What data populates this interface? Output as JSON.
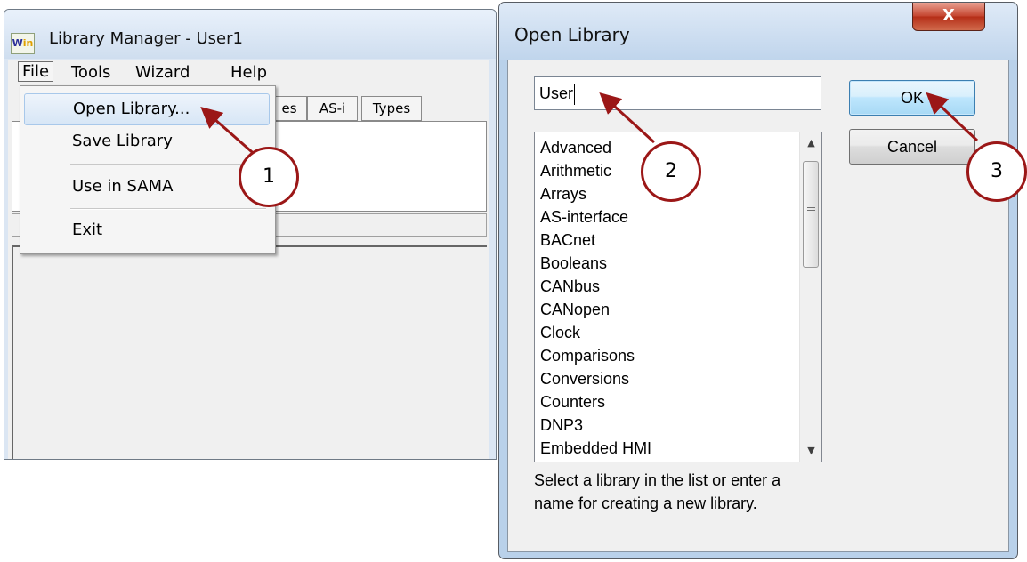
{
  "library_manager": {
    "title": "Library Manager - User1",
    "app_icon_text": "W",
    "app_icon_accent": "in",
    "menu": [
      "File",
      "Tools",
      "Wizard",
      "Help"
    ],
    "tabs": [
      "es",
      "AS-i",
      "Types"
    ],
    "file_menu": {
      "items": [
        "Open Library...",
        "Save Library",
        "Use in SAMA",
        "Exit"
      ],
      "highlighted": "Open Library..."
    }
  },
  "open_library_dialog": {
    "title": "Open Library",
    "close_label": "X",
    "name_input_value": "User",
    "library_list": [
      "Advanced",
      "Arithmetic",
      "Arrays",
      "AS-interface",
      "BACnet",
      "Booleans",
      "CANbus",
      "CANopen",
      "Clock",
      "Comparisons",
      "Conversions",
      "Counters",
      "DNP3",
      "Embedded HMI"
    ],
    "scroll_up_glyph": "▲",
    "scroll_down_glyph": "▼",
    "help_text_line1": "Select a library in the list or enter a",
    "help_text_line2": "name for creating a new library.",
    "ok_label": "OK",
    "cancel_label": "Cancel"
  },
  "annotations": {
    "step_labels": [
      "1",
      "2",
      "3"
    ],
    "color": "#9b1717"
  }
}
